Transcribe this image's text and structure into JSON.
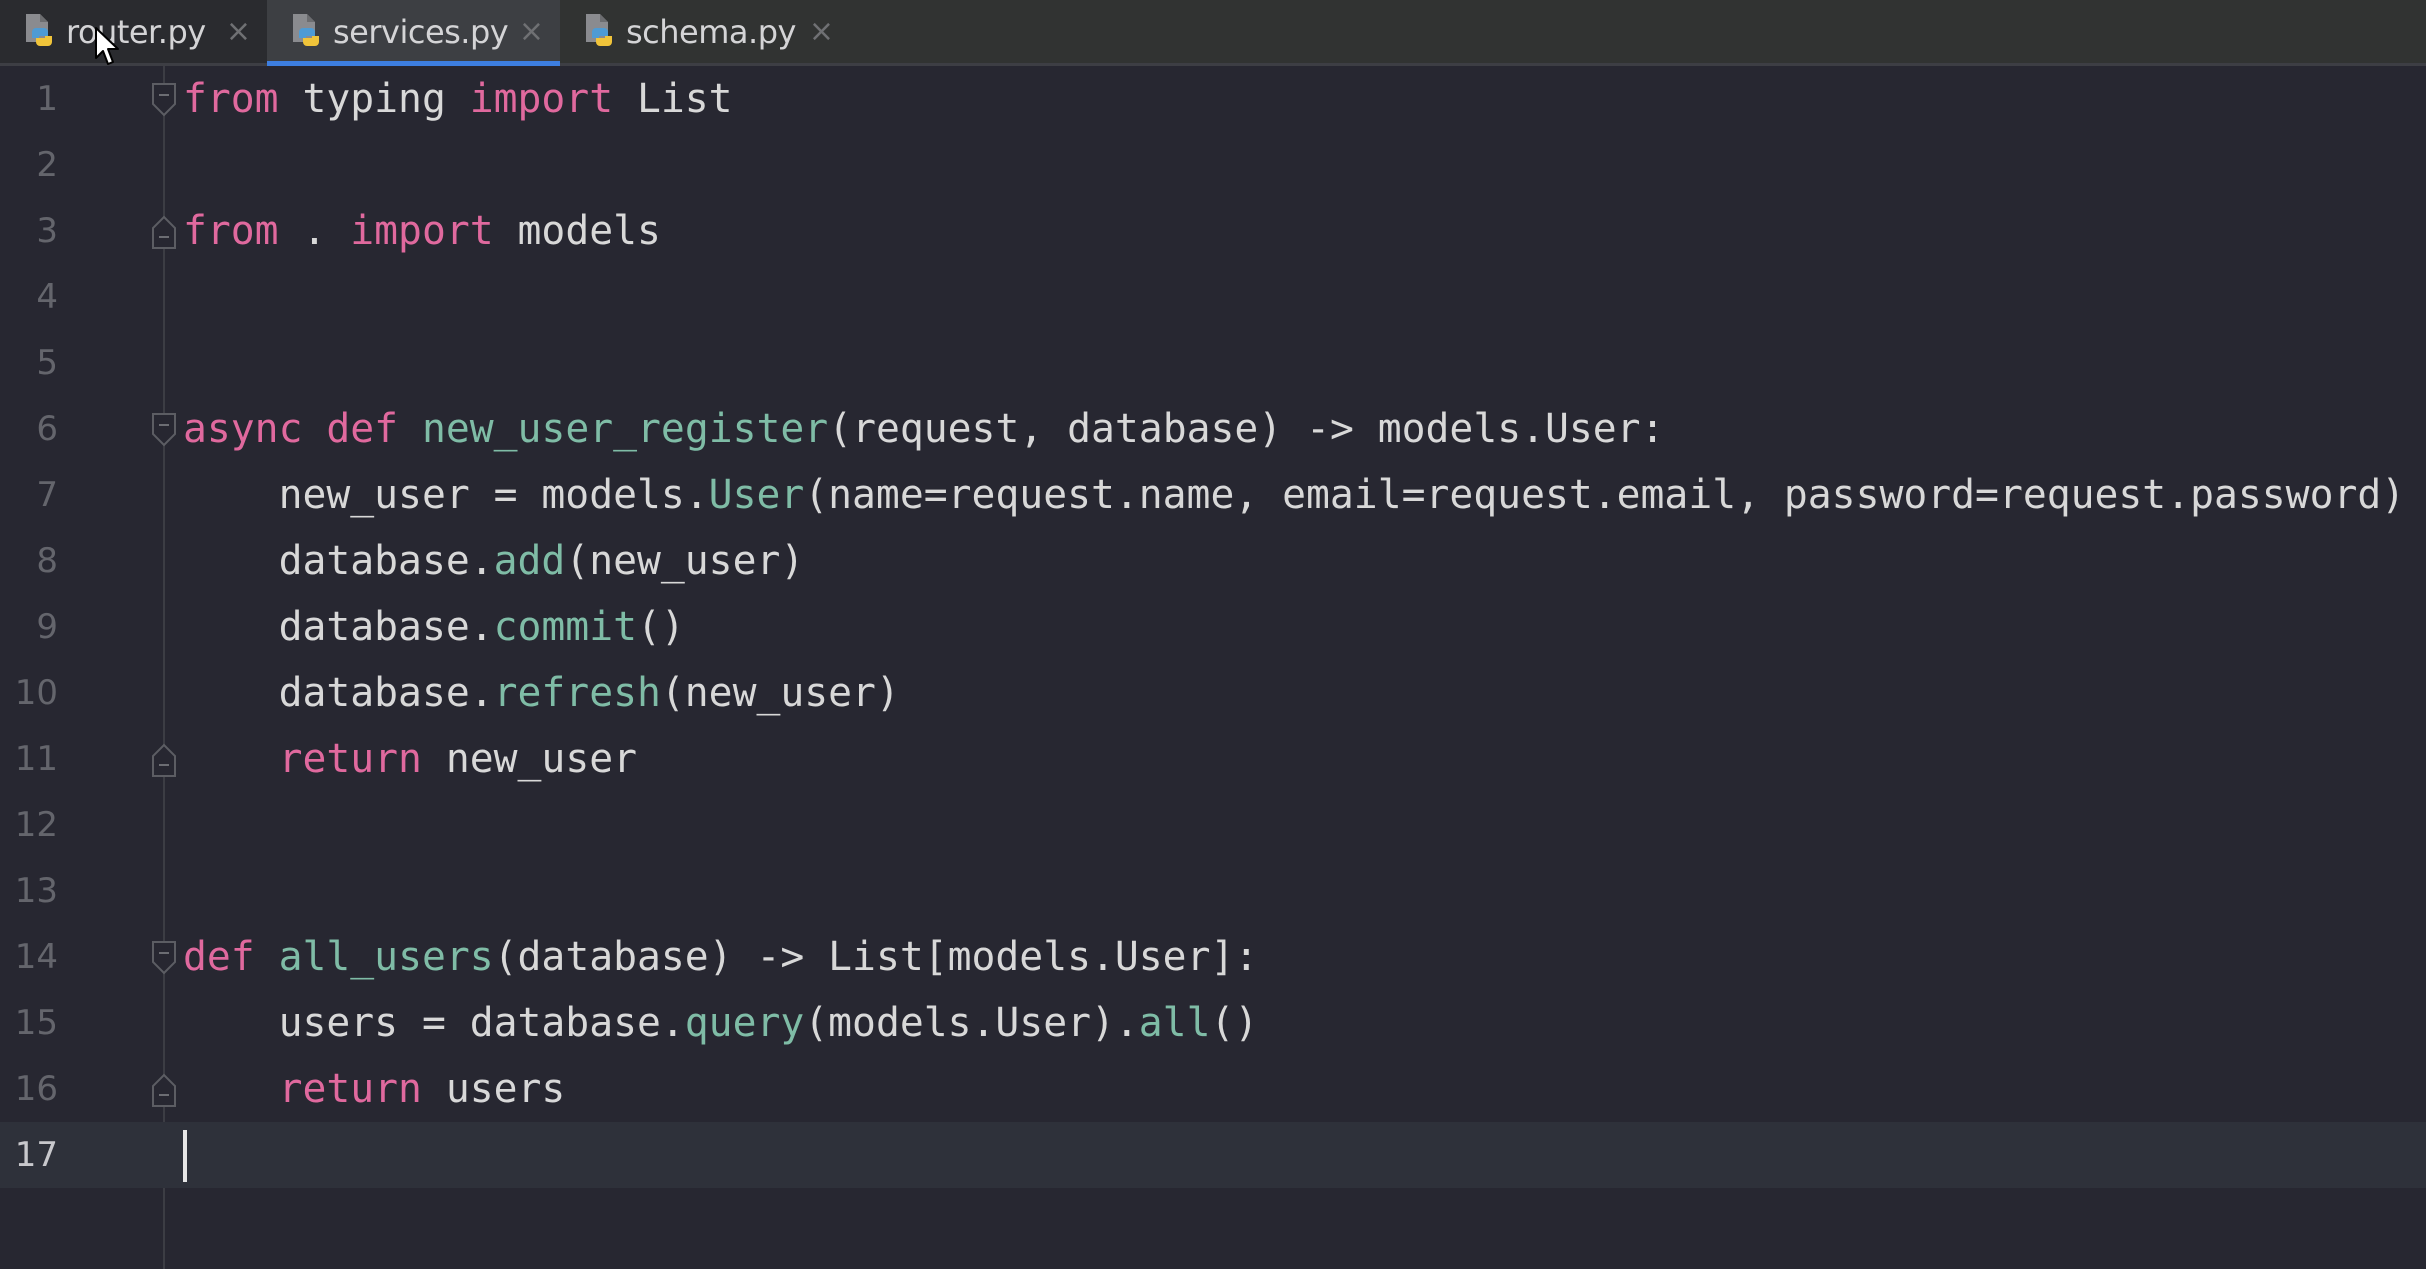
{
  "tabs": [
    {
      "label": "router.py",
      "icon": "python-file-icon",
      "active": false
    },
    {
      "label": "services.py",
      "icon": "python-file-icon",
      "active": true
    },
    {
      "label": "schema.py",
      "icon": "python-file-icon",
      "active": false
    }
  ],
  "close_glyph": "×",
  "colors": {
    "keyword": "#e0699e",
    "function": "#7fbca6",
    "text": "#d8d8d8",
    "accent": "#3d7ee0",
    "line_number": "#64656c",
    "current_line": "#2e313a"
  },
  "editor": {
    "current_line": 17,
    "lines": [
      {
        "n": "1",
        "fold": "start",
        "tokens": [
          [
            "kw",
            "from"
          ],
          [
            "tx",
            " typing "
          ],
          [
            "kw",
            "import"
          ],
          [
            "tx",
            " List"
          ]
        ]
      },
      {
        "n": "2",
        "tokens": []
      },
      {
        "n": "3",
        "fold": "end",
        "tokens": [
          [
            "kw",
            "from"
          ],
          [
            "tx",
            " . "
          ],
          [
            "kw",
            "import"
          ],
          [
            "tx",
            " models"
          ]
        ]
      },
      {
        "n": "4",
        "tokens": []
      },
      {
        "n": "5",
        "tokens": []
      },
      {
        "n": "6",
        "fold": "start",
        "tokens": [
          [
            "kw",
            "async"
          ],
          [
            "tx",
            " "
          ],
          [
            "kw",
            "def"
          ],
          [
            "tx",
            " "
          ],
          [
            "fn",
            "new_user_register"
          ],
          [
            "tx",
            "(request, database) -> models.User:"
          ]
        ]
      },
      {
        "n": "7",
        "tokens": [
          [
            "tx",
            "    new_user = models."
          ],
          [
            "fn",
            "User"
          ],
          [
            "tx",
            "(name=request.name, email=request.email, password=request.password)"
          ]
        ]
      },
      {
        "n": "8",
        "tokens": [
          [
            "tx",
            "    database."
          ],
          [
            "fn",
            "add"
          ],
          [
            "tx",
            "(new_user)"
          ]
        ]
      },
      {
        "n": "9",
        "tokens": [
          [
            "tx",
            "    database."
          ],
          [
            "fn",
            "commit"
          ],
          [
            "tx",
            "()"
          ]
        ]
      },
      {
        "n": "10",
        "tokens": [
          [
            "tx",
            "    database."
          ],
          [
            "fn",
            "refresh"
          ],
          [
            "tx",
            "(new_user)"
          ]
        ]
      },
      {
        "n": "11",
        "fold": "end",
        "tokens": [
          [
            "tx",
            "    "
          ],
          [
            "kw",
            "return"
          ],
          [
            "tx",
            " new_user"
          ]
        ]
      },
      {
        "n": "12",
        "tokens": []
      },
      {
        "n": "13",
        "tokens": []
      },
      {
        "n": "14",
        "fold": "start",
        "tokens": [
          [
            "kw",
            "def"
          ],
          [
            "tx",
            " "
          ],
          [
            "fn",
            "all_users"
          ],
          [
            "tx",
            "(database) -> List[models.User]:"
          ]
        ]
      },
      {
        "n": "15",
        "tokens": [
          [
            "tx",
            "    users = database."
          ],
          [
            "fn",
            "query"
          ],
          [
            "tx",
            "(models.User)."
          ],
          [
            "fn",
            "all"
          ],
          [
            "tx",
            "()"
          ]
        ]
      },
      {
        "n": "16",
        "fold": "end",
        "tokens": [
          [
            "tx",
            "    "
          ],
          [
            "kw",
            "return"
          ],
          [
            "tx",
            " users"
          ]
        ]
      },
      {
        "n": "17",
        "tokens": []
      }
    ]
  }
}
